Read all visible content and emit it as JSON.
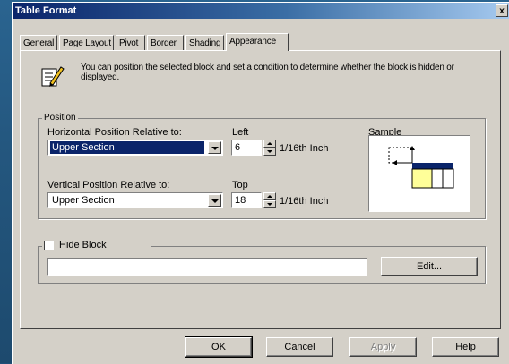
{
  "window": {
    "title": "Table Format",
    "close_glyph": "x"
  },
  "tabs": [
    {
      "label": "General",
      "active": false
    },
    {
      "label": "Page Layout",
      "active": false
    },
    {
      "label": "Pivot",
      "active": false
    },
    {
      "label": "Border",
      "active": false
    },
    {
      "label": "Shading",
      "active": false
    },
    {
      "label": "Appearance",
      "active": true
    }
  ],
  "info": {
    "icon": "edit-pencil-icon",
    "text": "You can position the selected block and set a condition to determine whether the block is hidden or displayed."
  },
  "position": {
    "group_label": "Position",
    "horizontal": {
      "label": "Horizontal Position Relative to:",
      "value": "Upper Section"
    },
    "left": {
      "label": "Left",
      "value": "6",
      "unit": "1/16th Inch"
    },
    "vertical": {
      "label": "Vertical Position Relative to:",
      "value": "Upper Section"
    },
    "top": {
      "label": "Top",
      "value": "18",
      "unit": "1/16th Inch"
    },
    "sample_label": "Sample"
  },
  "hide_block": {
    "label": "Hide Block",
    "checked": false,
    "condition": "",
    "edit_label": "Edit..."
  },
  "buttons": {
    "ok": "OK",
    "cancel": "Cancel",
    "apply": "Apply",
    "help": "Help"
  },
  "colors": {
    "selection": "#0a246a",
    "sample_header": "#0a246a",
    "sample_cell": "#ffff99",
    "face": "#d4d0c8"
  }
}
